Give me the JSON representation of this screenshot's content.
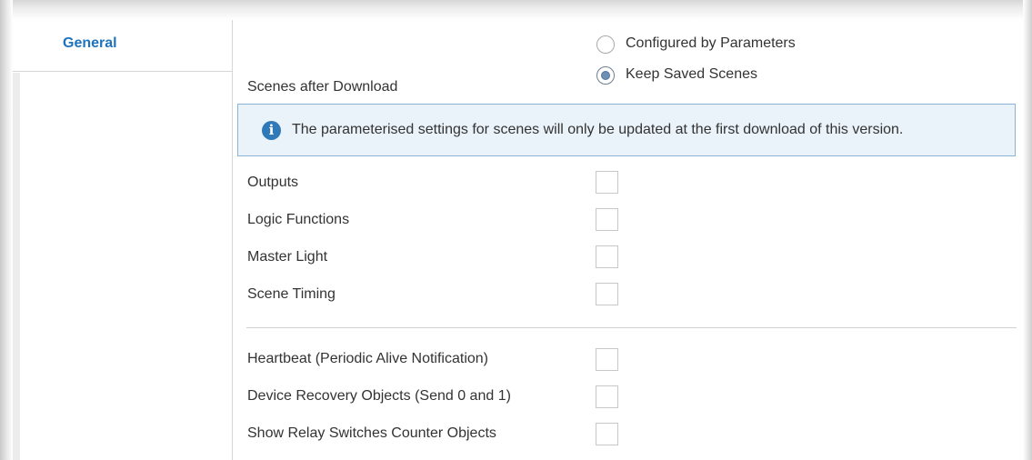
{
  "sidebar": {
    "items": [
      {
        "label": "General"
      }
    ]
  },
  "scenes": {
    "label": "Scenes after Download",
    "options": [
      {
        "label": "Configured by Parameters",
        "selected": false
      },
      {
        "label": "Keep Saved Scenes",
        "selected": true
      }
    ]
  },
  "info": {
    "icon": "info-icon",
    "text": "The parameterised settings for scenes will only be updated at the first download of this version."
  },
  "checkbox_group_1": [
    {
      "label": "Outputs",
      "checked": false
    },
    {
      "label": "Logic Functions",
      "checked": false
    },
    {
      "label": "Master Light",
      "checked": false
    },
    {
      "label": "Scene Timing",
      "checked": false
    }
  ],
  "checkbox_group_2": [
    {
      "label": "Heartbeat (Periodic Alive Notification)",
      "checked": false
    },
    {
      "label": "Device Recovery Objects (Send 0 and 1)",
      "checked": false
    },
    {
      "label": "Show Relay Switches Counter Objects",
      "checked": false
    }
  ],
  "colors": {
    "accent": "#1e73be",
    "info_background": "#eaf2fa",
    "info_border": "#8bb3d6",
    "info_icon": "#2f79b8"
  }
}
